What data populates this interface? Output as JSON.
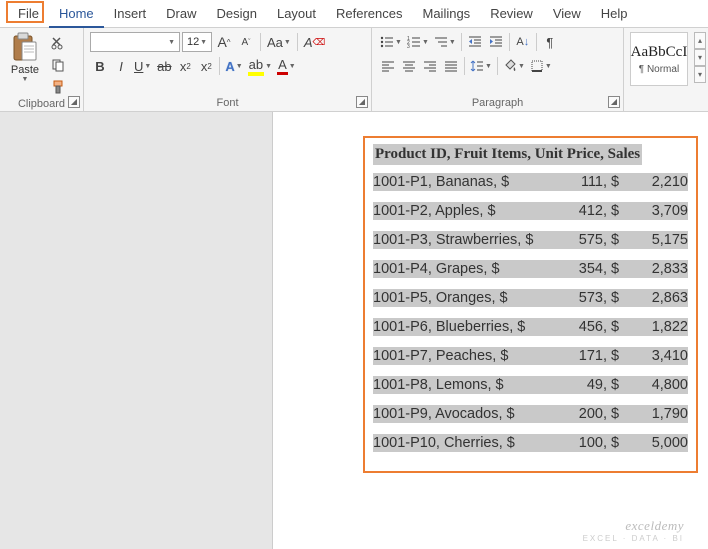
{
  "tabs": {
    "file": "File",
    "home": "Home",
    "insert": "Insert",
    "draw": "Draw",
    "design": "Design",
    "layout": "Layout",
    "references": "References",
    "mailings": "Mailings",
    "review": "Review",
    "view": "View",
    "help": "Help"
  },
  "ribbon": {
    "clipboard": {
      "label": "Clipboard",
      "paste": "Paste"
    },
    "font": {
      "label": "Font",
      "name": "",
      "size": "12"
    },
    "paragraph": {
      "label": "Paragraph"
    },
    "styles": {
      "sample": "AaBbCcI",
      "name": "¶ Normal"
    }
  },
  "document": {
    "header": "Product ID, Fruit Items, Unit Price, Sales",
    "rows": [
      {
        "lead": "1001-P1, Bananas, $",
        "v1": "111",
        "mid": ", $",
        "v2": "2,210"
      },
      {
        "lead": "1001-P2, Apples, $",
        "v1": "412",
        "mid": ", $",
        "v2": "3,709"
      },
      {
        "lead": "1001-P3, Strawberries, $",
        "v1": "575",
        "mid": ", $",
        "v2": "5,175"
      },
      {
        "lead": "1001-P4, Grapes, $",
        "v1": "354",
        "mid": ", $",
        "v2": "2,833"
      },
      {
        "lead": "1001-P5, Oranges, $",
        "v1": "573",
        "mid": ", $",
        "v2": "2,863"
      },
      {
        "lead": "1001-P6, Blueberries, $",
        "v1": "456",
        "mid": ", $",
        "v2": "1,822"
      },
      {
        "lead": "1001-P7, Peaches, $",
        "v1": "171",
        "mid": ", $",
        "v2": "3,410"
      },
      {
        "lead": "1001-P8, Lemons, $",
        "v1": "49",
        "mid": ", $",
        "v2": "4,800"
      },
      {
        "lead": "1001-P9, Avocados, $",
        "v1": "200",
        "mid": ", $",
        "v2": "1,790"
      },
      {
        "lead": "1001-P10, Cherries, $",
        "v1": "100",
        "mid": ", $",
        "v2": "5,000"
      }
    ]
  },
  "watermark": {
    "line1": "exceldemy",
    "line2": "EXCEL · DATA · BI"
  },
  "chart_data": {
    "type": "table",
    "columns": [
      "Product ID",
      "Fruit Items",
      "Unit Price",
      "Sales"
    ],
    "rows": [
      [
        "1001-P1",
        "Bananas",
        111,
        2210
      ],
      [
        "1001-P2",
        "Apples",
        412,
        3709
      ],
      [
        "1001-P3",
        "Strawberries",
        575,
        5175
      ],
      [
        "1001-P4",
        "Grapes",
        354,
        2833
      ],
      [
        "1001-P5",
        "Oranges",
        573,
        2863
      ],
      [
        "1001-P6",
        "Blueberries",
        456,
        1822
      ],
      [
        "1001-P7",
        "Peaches",
        171,
        3410
      ],
      [
        "1001-P8",
        "Lemons",
        49,
        4800
      ],
      [
        "1001-P9",
        "Avocados",
        200,
        1790
      ],
      [
        "1001-P10",
        "Cherries",
        100,
        5000
      ]
    ]
  }
}
